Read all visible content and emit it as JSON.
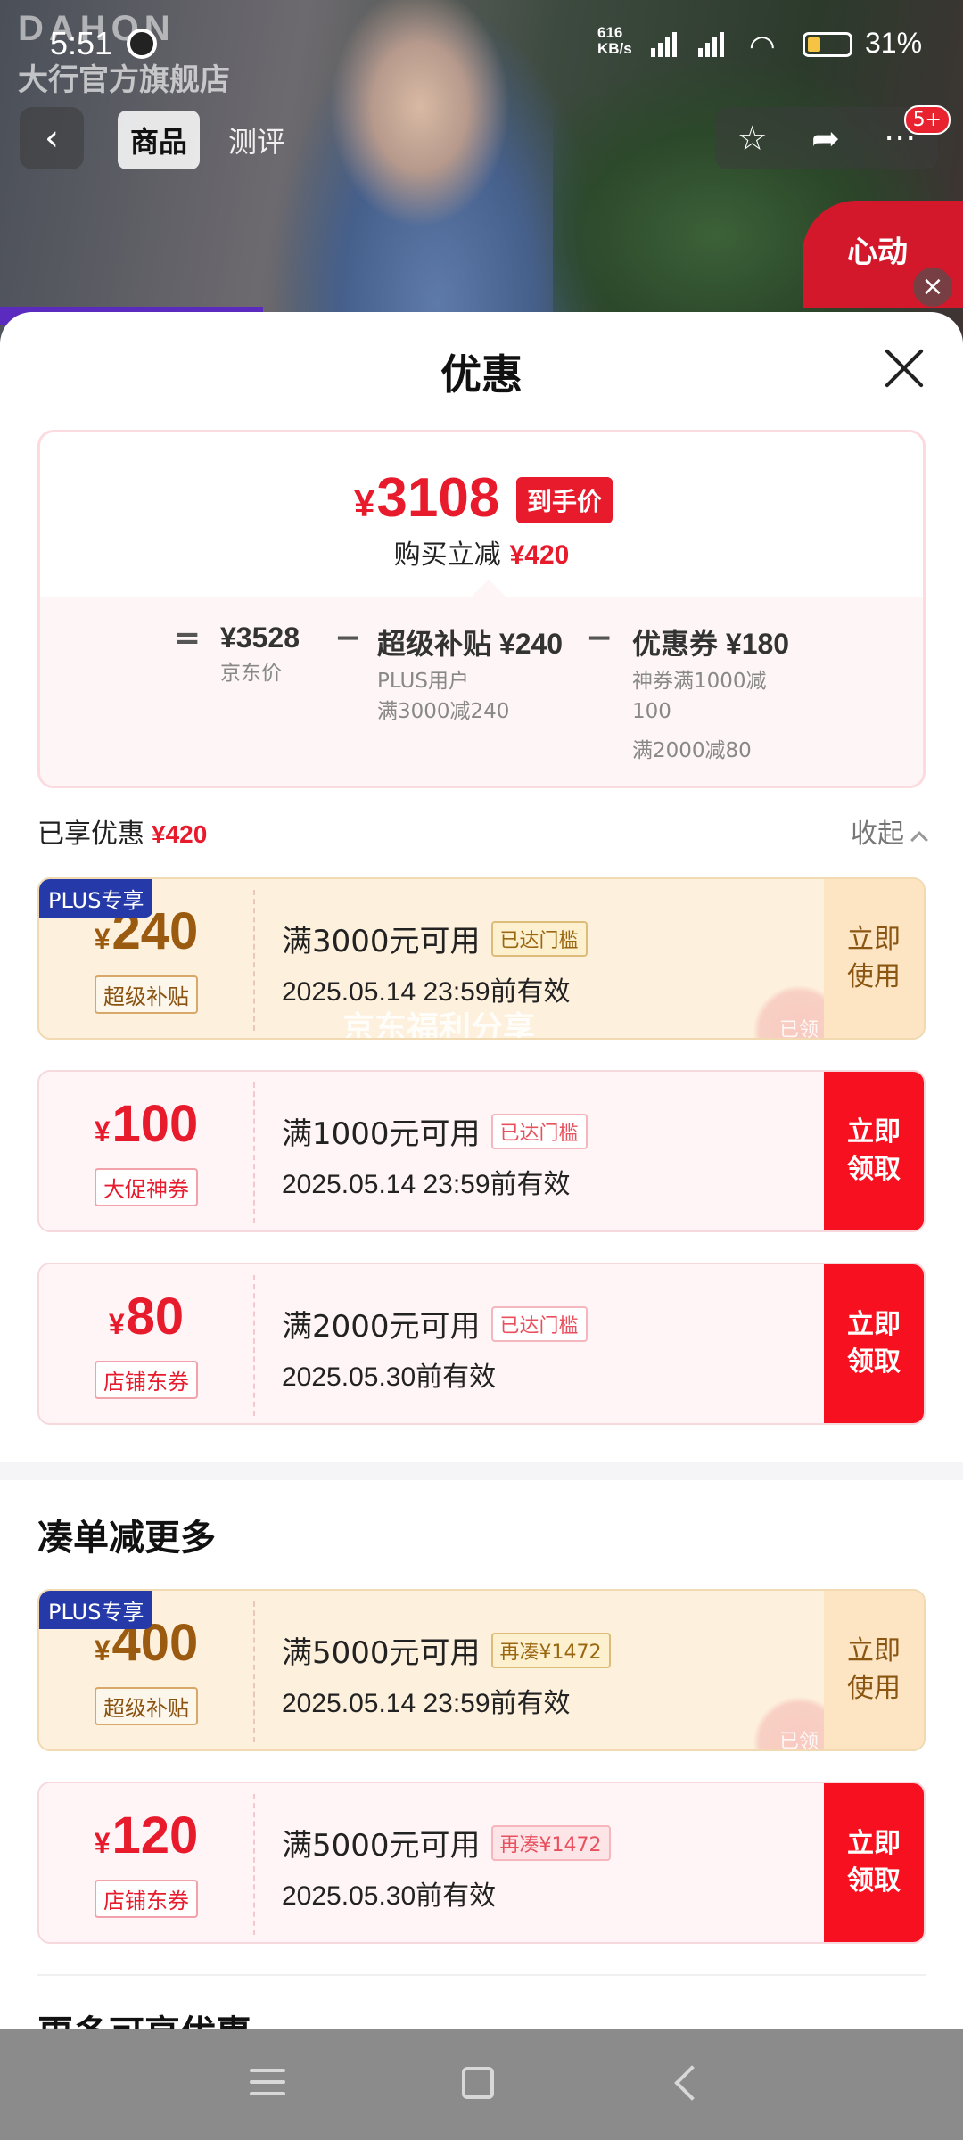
{
  "status_bar": {
    "time": "5:51",
    "net_speed_value": "616",
    "net_speed_unit": "KB/s",
    "battery_percent": "31%"
  },
  "background": {
    "brand_watermark": "DAHON",
    "store_name": "大行官方旗舰店",
    "promo_text": "心动"
  },
  "nav": {
    "tabs": [
      {
        "label": "商品",
        "active": true
      },
      {
        "label": "测评",
        "active": false
      }
    ],
    "notification_badge": "5+"
  },
  "sheet": {
    "title": "优惠"
  },
  "summary": {
    "currency": "¥",
    "final_price": "3108",
    "final_price_tag": "到手价",
    "instant_cut_label": "购买立减",
    "instant_cut_amount": "¥420",
    "breakdown": {
      "jd_price": "¥3528",
      "jd_price_label": "京东价",
      "subsidy_main": "超级补贴 ¥240",
      "subsidy_sub1": "PLUS用户",
      "subsidy_sub2": "满3000减240",
      "coupon_main": "优惠券 ¥180",
      "coupon_sub1": "神券满1000减",
      "coupon_sub2": "100",
      "coupon_sub3": "满2000减80"
    }
  },
  "enjoyed": {
    "label": "已享优惠",
    "amount": "¥420",
    "collapse_label": "收起"
  },
  "coupons": [
    {
      "plus_tag": "PLUS专享",
      "value": "240",
      "type": "超级补贴",
      "condition": "满3000元可用",
      "badge": "已达门槛",
      "expiry": "2025.05.14 23:59前有效",
      "action": "立即使用",
      "action_line1": "立即",
      "action_line2": "使用",
      "stamp": "已领",
      "watermark": "京东福利分享"
    },
    {
      "value": "100",
      "type": "大促神券",
      "condition": "满1000元可用",
      "badge": "已达门槛",
      "expiry": "2025.05.14 23:59前有效",
      "action_line1": "立即",
      "action_line2": "领取"
    },
    {
      "value": "80",
      "type": "店铺东券",
      "condition": "满2000元可用",
      "badge": "已达门槛",
      "expiry": "2025.05.30前有效",
      "action_line1": "立即",
      "action_line2": "领取"
    }
  ],
  "more_section": {
    "title": "凑单减更多",
    "coupons": [
      {
        "plus_tag": "PLUS专享",
        "value": "400",
        "type": "超级补贴",
        "condition": "满5000元可用",
        "badge": "再凑¥1472",
        "expiry": "2025.05.14 23:59前有效",
        "action_line1": "立即",
        "action_line2": "使用",
        "stamp": "已领"
      },
      {
        "value": "120",
        "type": "店铺东券",
        "condition": "满5000元可用",
        "badge": "再凑¥1472",
        "expiry": "2025.05.30前有效",
        "action_line1": "立即",
        "action_line2": "领取"
      }
    ]
  },
  "more_available_title": "更多可享优惠"
}
